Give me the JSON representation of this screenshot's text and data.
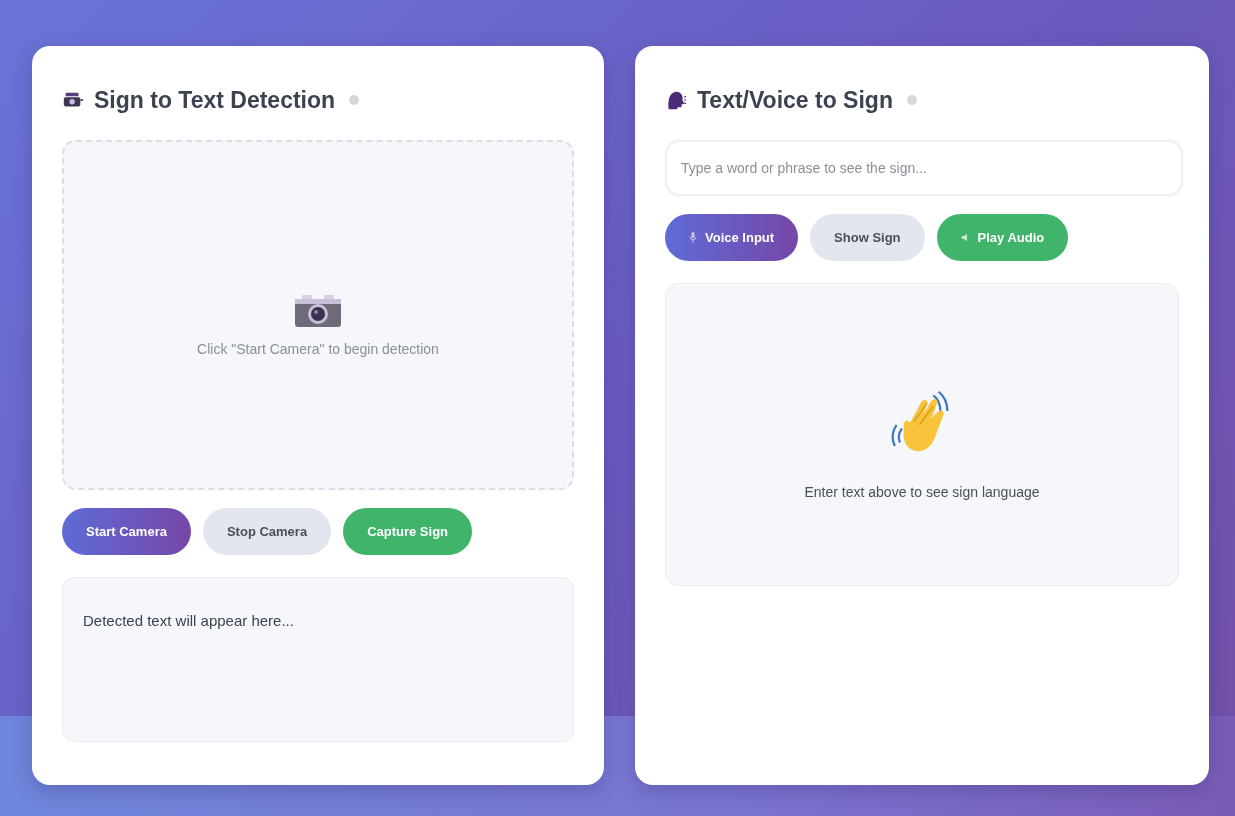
{
  "panels": [
    {
      "kind": "detection",
      "title": "Sign to Text Detection",
      "camera_area": {
        "message": "Click \"Start Camera\" to begin detection"
      },
      "buttons": [
        {
          "label": "Start Camera",
          "kind": "primary"
        },
        {
          "label": "Stop Camera",
          "kind": "secondary"
        },
        {
          "label": "Capture Sign",
          "kind": "success"
        }
      ],
      "result": {
        "placeholder": "Detected text will appear here..."
      }
    },
    {
      "kind": "translation",
      "title": "Text/Voice to Sign",
      "input": {
        "placeholder": "Type a word or phrase to see the sign..."
      },
      "buttons": [
        {
          "label": "Voice Input",
          "kind": "primary"
        },
        {
          "label": "Show Sign",
          "kind": "secondary"
        },
        {
          "label": "Play Audio",
          "kind": "success"
        }
      ],
      "sign_display": {
        "message": "Enter text above to see sign language"
      }
    }
  ]
}
